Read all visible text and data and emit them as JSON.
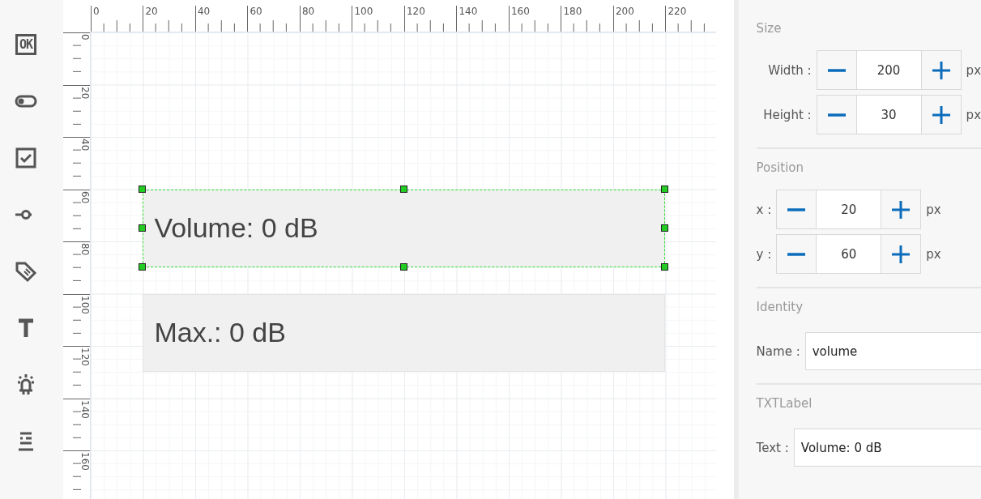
{
  "tools": [
    {
      "kind": "button",
      "label": "OK"
    },
    {
      "kind": "toggle"
    },
    {
      "kind": "checkbox"
    },
    {
      "kind": "slider"
    },
    {
      "kind": "tag"
    },
    {
      "kind": "text"
    },
    {
      "kind": "light"
    },
    {
      "kind": "meter"
    }
  ],
  "ruler": {
    "top_labels": [
      "0",
      "20",
      "40",
      "60",
      "80",
      "100",
      "120",
      "140",
      "160",
      "180",
      "200",
      "220"
    ],
    "side_labels": [
      "0",
      "20",
      "40",
      "60",
      "80",
      "100",
      "120",
      "140",
      "160"
    ]
  },
  "canvas": {
    "widgets": [
      {
        "text": "Volume: 0 dB",
        "selected": true
      },
      {
        "text": "Max.: 0 dB",
        "selected": false
      }
    ]
  },
  "properties": {
    "sections": [
      {
        "title": "Size",
        "fields": [
          {
            "kind": "stepper",
            "label": "Width :",
            "value": "200",
            "unit": "px"
          },
          {
            "kind": "stepper",
            "label": "Height :",
            "value": "30",
            "unit": "px"
          }
        ]
      },
      {
        "title": "Position",
        "fields": [
          {
            "kind": "stepper",
            "label": "x :",
            "value": "20",
            "unit": "px"
          },
          {
            "kind": "stepper",
            "label": "y :",
            "value": "60",
            "unit": "px"
          }
        ]
      },
      {
        "title": "Identity",
        "fields": [
          {
            "kind": "text",
            "label": "Name :",
            "value": "volume"
          }
        ]
      },
      {
        "title": "TXTLabel",
        "fields": [
          {
            "kind": "text",
            "label": "Text :",
            "value": "Volume: 0 dB"
          }
        ]
      }
    ]
  }
}
